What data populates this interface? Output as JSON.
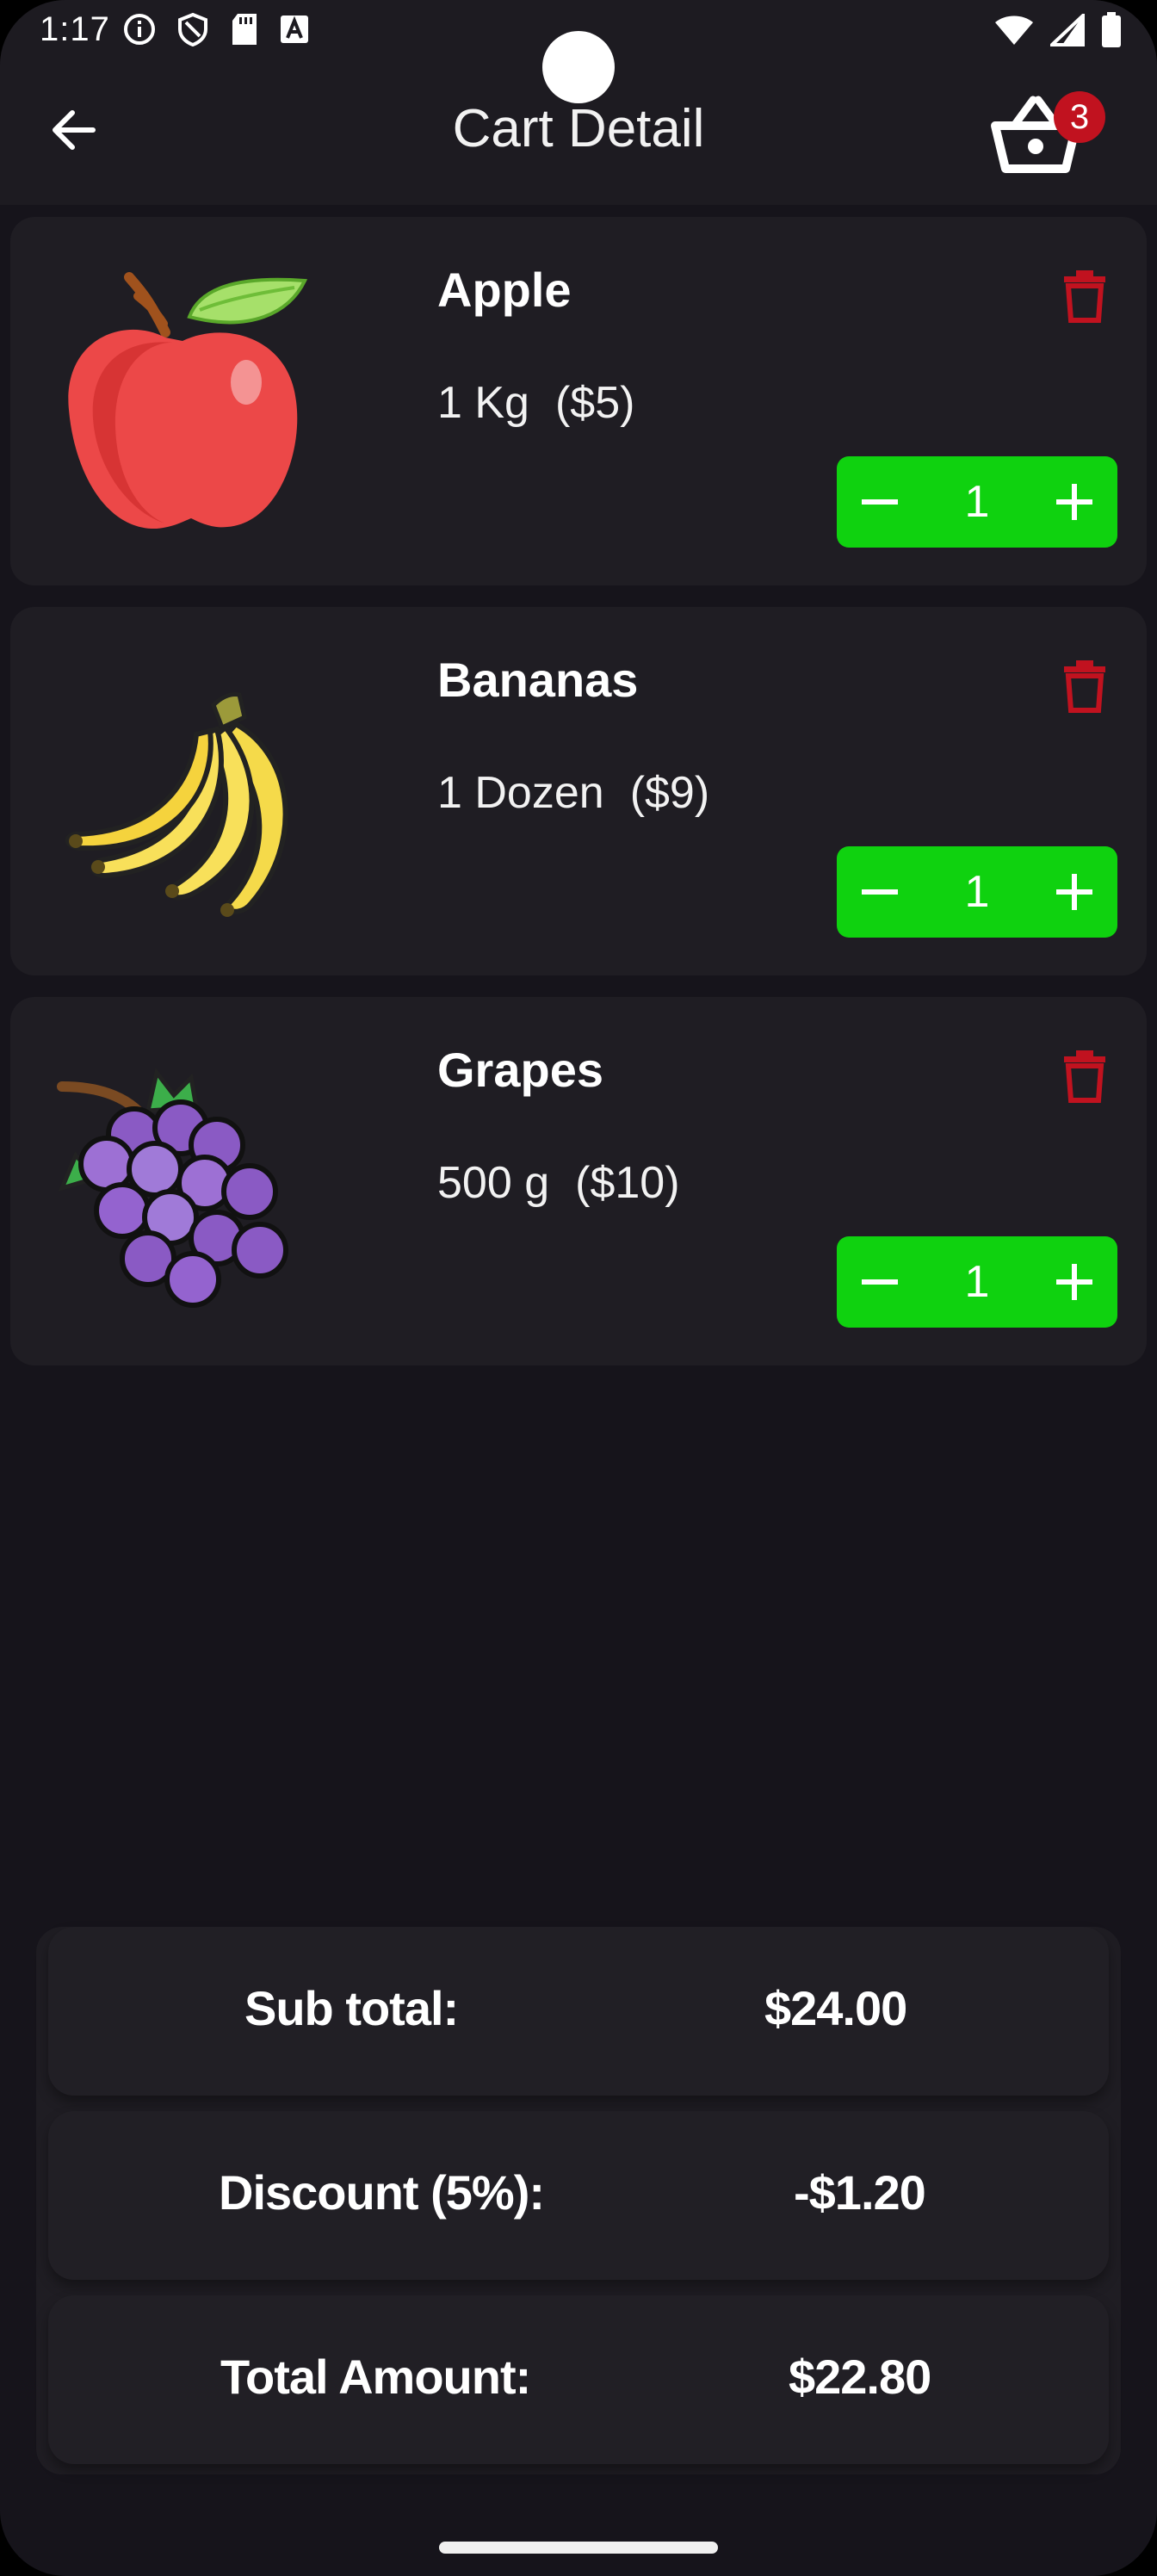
{
  "status_bar": {
    "time": "1:17",
    "left_icons": [
      "info-icon",
      "shield-icon",
      "sd-card-icon",
      "a-icon"
    ],
    "right_icons": [
      "wifi-icon",
      "signal-icon",
      "battery-icon"
    ]
  },
  "app_bar": {
    "title": "Cart Detail",
    "back_icon": "arrow-left-icon",
    "cart_icon": "basket-icon",
    "cart_count": "3",
    "badge_color": "#c1121f"
  },
  "items": [
    {
      "name": "Apple",
      "unit": "1 Kg",
      "price": "($5)",
      "quantity": "1",
      "image_icon": "apple-icon"
    },
    {
      "name": "Bananas",
      "unit": "1 Dozen",
      "price": "($9)",
      "quantity": "1",
      "image_icon": "bananas-icon"
    },
    {
      "name": "Grapes",
      "unit": "500 g",
      "price": "($10)",
      "quantity": "1",
      "image_icon": "grapes-icon"
    }
  ],
  "stepper_color": "#0fd20f",
  "delete_color": "#c1121f",
  "summary": {
    "subtotal_label": "Sub total:",
    "subtotal_value": "$24.00",
    "discount_label": "Discount (5%):",
    "discount_value": "-$1.20",
    "total_label": "Total Amount:",
    "total_value": "$22.80"
  }
}
